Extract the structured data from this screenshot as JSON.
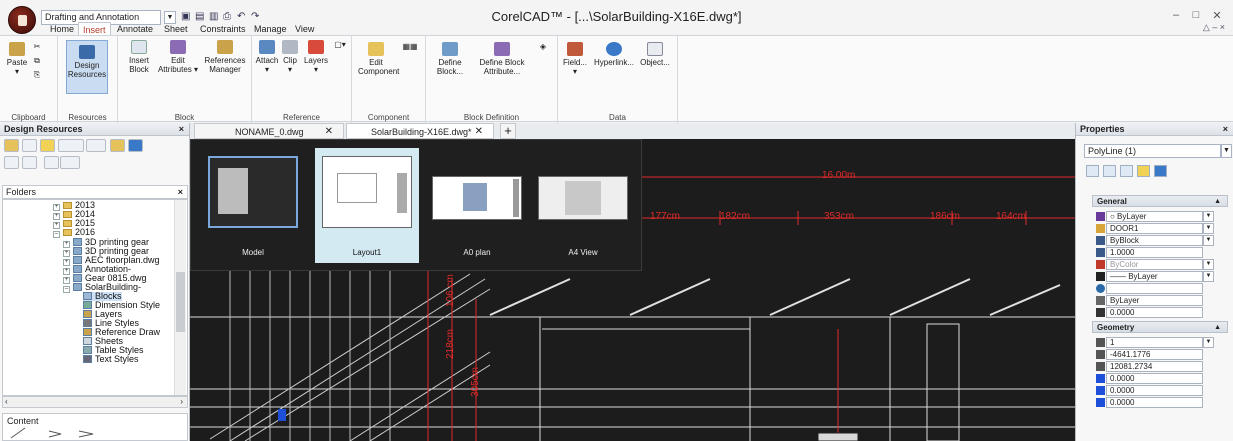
{
  "titlebar": {
    "workspace": "Drafting and Annotation",
    "window_title": "CorelCAD™ - [...\\SolarBuilding-X16E.dwg*]",
    "controls": [
      "–",
      "□",
      "✕"
    ],
    "doc_controls": "△ – ×"
  },
  "ribbon_tabs": [
    "Home",
    "Insert",
    "Annotate",
    "Sheet",
    "Constraints",
    "Manage",
    "View"
  ],
  "active_tab": "Insert",
  "ribbon": {
    "clipboard": {
      "label": "Clipboard",
      "paste": "Paste"
    },
    "resources": {
      "label": "Resources",
      "design": "Design Resources"
    },
    "block": {
      "label": "Block",
      "insert": "Insert Block",
      "edit": "Edit Attributes",
      "refman": "References Manager"
    },
    "reference": {
      "label": "Reference",
      "attach": "Attach",
      "clip": "Clip",
      "layers": "Layers"
    },
    "component": {
      "label": "Component",
      "edit": "Edit Component"
    },
    "blockdef": {
      "label": "Block Definition",
      "define": "Define Block...",
      "defattr": "Define Block Attribute..."
    },
    "data": {
      "label": "Data",
      "field": "Field...",
      "hyperlink": "Hyperlink...",
      "object": "Object..."
    }
  },
  "doc_tabs": [
    {
      "label": "NONAME_0.dwg"
    },
    {
      "label": "SolarBuilding-X16E.dwg*"
    }
  ],
  "left_panel": {
    "title": "Design Resources",
    "folders_label": "Folders",
    "content_label": "Content",
    "tree": [
      {
        "label": "2013"
      },
      {
        "label": "2014"
      },
      {
        "label": "2015"
      },
      {
        "label": "2016"
      },
      {
        "label": "3D printing gear"
      },
      {
        "label": "3D printing gear"
      },
      {
        "label": "AEC floorplan.dwg"
      },
      {
        "label": "Annotation-"
      },
      {
        "label": "Gear 0815.dwg"
      },
      {
        "label": "SolarBuilding-"
      },
      {
        "label": "Blocks"
      },
      {
        "label": "Dimension Style"
      },
      {
        "label": "Layers"
      },
      {
        "label": "Line Styles"
      },
      {
        "label": "Reference Draw"
      },
      {
        "label": "Sheets"
      },
      {
        "label": "Table Styles"
      },
      {
        "label": "Text Styles"
      }
    ]
  },
  "layouts": [
    {
      "label": "Model"
    },
    {
      "label": "Layout1"
    },
    {
      "label": "A0 plan"
    },
    {
      "label": "A4 View"
    }
  ],
  "dimensions": {
    "top": "16.00m",
    "row": [
      "177cm",
      "182cm",
      "353cm",
      "186cm",
      "164cm"
    ],
    "v1": "106 cm",
    "v2": "218cm",
    "v3": "305cm"
  },
  "properties": {
    "title": "Properties",
    "selection": "PolyLine (1)",
    "general_label": "General",
    "general": [
      {
        "value": "○ ByLayer",
        "icon_color": "#6a3a9a"
      },
      {
        "value": "DOOR1",
        "icon_color": "#d7a53a"
      },
      {
        "value": "ByBlock",
        "icon_color": "#3a5a8a"
      },
      {
        "value": "1.0000",
        "icon_color": "#3a5a8a"
      },
      {
        "value": "ByColor",
        "icon_color": "#c0392b"
      },
      {
        "value": "—— ByLayer",
        "icon_color": "#222222"
      },
      {
        "value": "",
        "icon_color": "#2a6aa8"
      },
      {
        "value": "ByLayer",
        "icon_color": "#666666"
      },
      {
        "value": "0.0000",
        "icon_color": "#333333"
      }
    ],
    "geometry_label": "Geometry",
    "geometry": [
      {
        "value": "1"
      },
      {
        "value": "-4641.1776"
      },
      {
        "value": "12081.2734"
      },
      {
        "value": "0.0000"
      },
      {
        "value": "0.0000"
      },
      {
        "value": "0.0000"
      }
    ]
  },
  "colors": {
    "accent": "#b53c2c",
    "canvas": "#1c1c1c",
    "dim": "#e02a2a",
    "selected": "#d4eaf3"
  }
}
